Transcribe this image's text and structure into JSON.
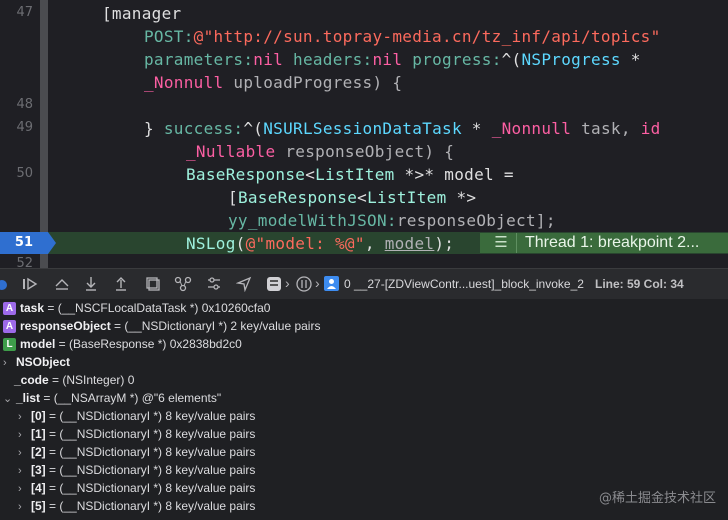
{
  "editor": {
    "line_numbers": [
      "47",
      "48",
      "49",
      "50",
      "51",
      "52"
    ],
    "code": {
      "l47": "[manager",
      "l47b_post": "POST:",
      "l47b_url": "@\"http://sun.topray-media.cn/tz_inf/api/topics\"",
      "l47c_params": "parameters:",
      "l47c_nil1": "nil",
      "l47c_headers": " headers:",
      "l47c_nil2": "nil",
      "l47c_progress": " progress:",
      "l47c_caret": "^(",
      "l47c_nsprogress": "NSProgress",
      "l47c_star": " *",
      "l47d_nonnull": "_Nonnull",
      "l47d_rest": " uploadProgress) {",
      "l49_close": "} ",
      "l49_success": "success:",
      "l49_caret": "^(",
      "l49_task_class": "NSURLSessionDataTask",
      "l49_star": " * ",
      "l49_nonnull": "_Nonnull",
      "l49_task": " task, ",
      "l49_id": "id",
      "l49b_nullable": "_Nullable",
      "l49b_rest": " responseObject) {",
      "l50_base": "BaseResponse",
      "l50_lt": "<",
      "l50_list": "ListItem",
      "l50_rest": " *>* model =",
      "l50b_open": "[",
      "l50b_base": "BaseResponse",
      "l50b_lt": "<",
      "l50b_list": "ListItem",
      "l50b_rest": " *>",
      "l50c_method": "yy_modelWithJSON:",
      "l50c_rest": "responseObject];",
      "l51_nslog": "NSLog",
      "l51_open": "(",
      "l51_fmt": "@\"model: %@\"",
      "l51_comma": ", ",
      "l51_model": "model",
      "l51_close": ");"
    },
    "breakpoint_line": "51",
    "thread_badge": "Thread 1: breakpoint 2..."
  },
  "toolbar": {
    "breadcrumb_frame": "0 __27-[ZDViewContr...uest]_block_invoke_2",
    "line_col": "Line: 59  Col: 34"
  },
  "variables": [
    {
      "badge": "A",
      "name": "task",
      "value": " = (__NSCFLocalDataTask *) 0x10260cfa0"
    },
    {
      "badge": "A",
      "name": "responseObject",
      "value": " = (__NSDictionaryI *) 2 key/value pairs"
    },
    {
      "badge": "L",
      "name": "model",
      "value": " = (BaseResponse *) 0x2838bd2c0"
    },
    {
      "chev": ">",
      "name": "NSObject",
      "value": ""
    },
    {
      "name": "_code",
      "value": " = (NSInteger) 0"
    },
    {
      "chev": "v",
      "name": "_list",
      "value": " = (__NSArrayM *) @\"6 elements\""
    },
    {
      "chev": ">",
      "name": "[0]",
      "value": " = (__NSDictionaryI *) 8 key/value pairs"
    },
    {
      "chev": ">",
      "name": "[1]",
      "value": " = (__NSDictionaryI *) 8 key/value pairs"
    },
    {
      "chev": ">",
      "name": "[2]",
      "value": " = (__NSDictionaryI *) 8 key/value pairs"
    },
    {
      "chev": ">",
      "name": "[3]",
      "value": " = (__NSDictionaryI *) 8 key/value pairs"
    },
    {
      "chev": ">",
      "name": "[4]",
      "value": " = (__NSDictionaryI *) 8 key/value pairs"
    },
    {
      "chev": ">",
      "name": "[5]",
      "value": " = (__NSDictionaryI *) 8 key/value pairs"
    }
  ],
  "watermark": "@稀土掘金技术社区"
}
